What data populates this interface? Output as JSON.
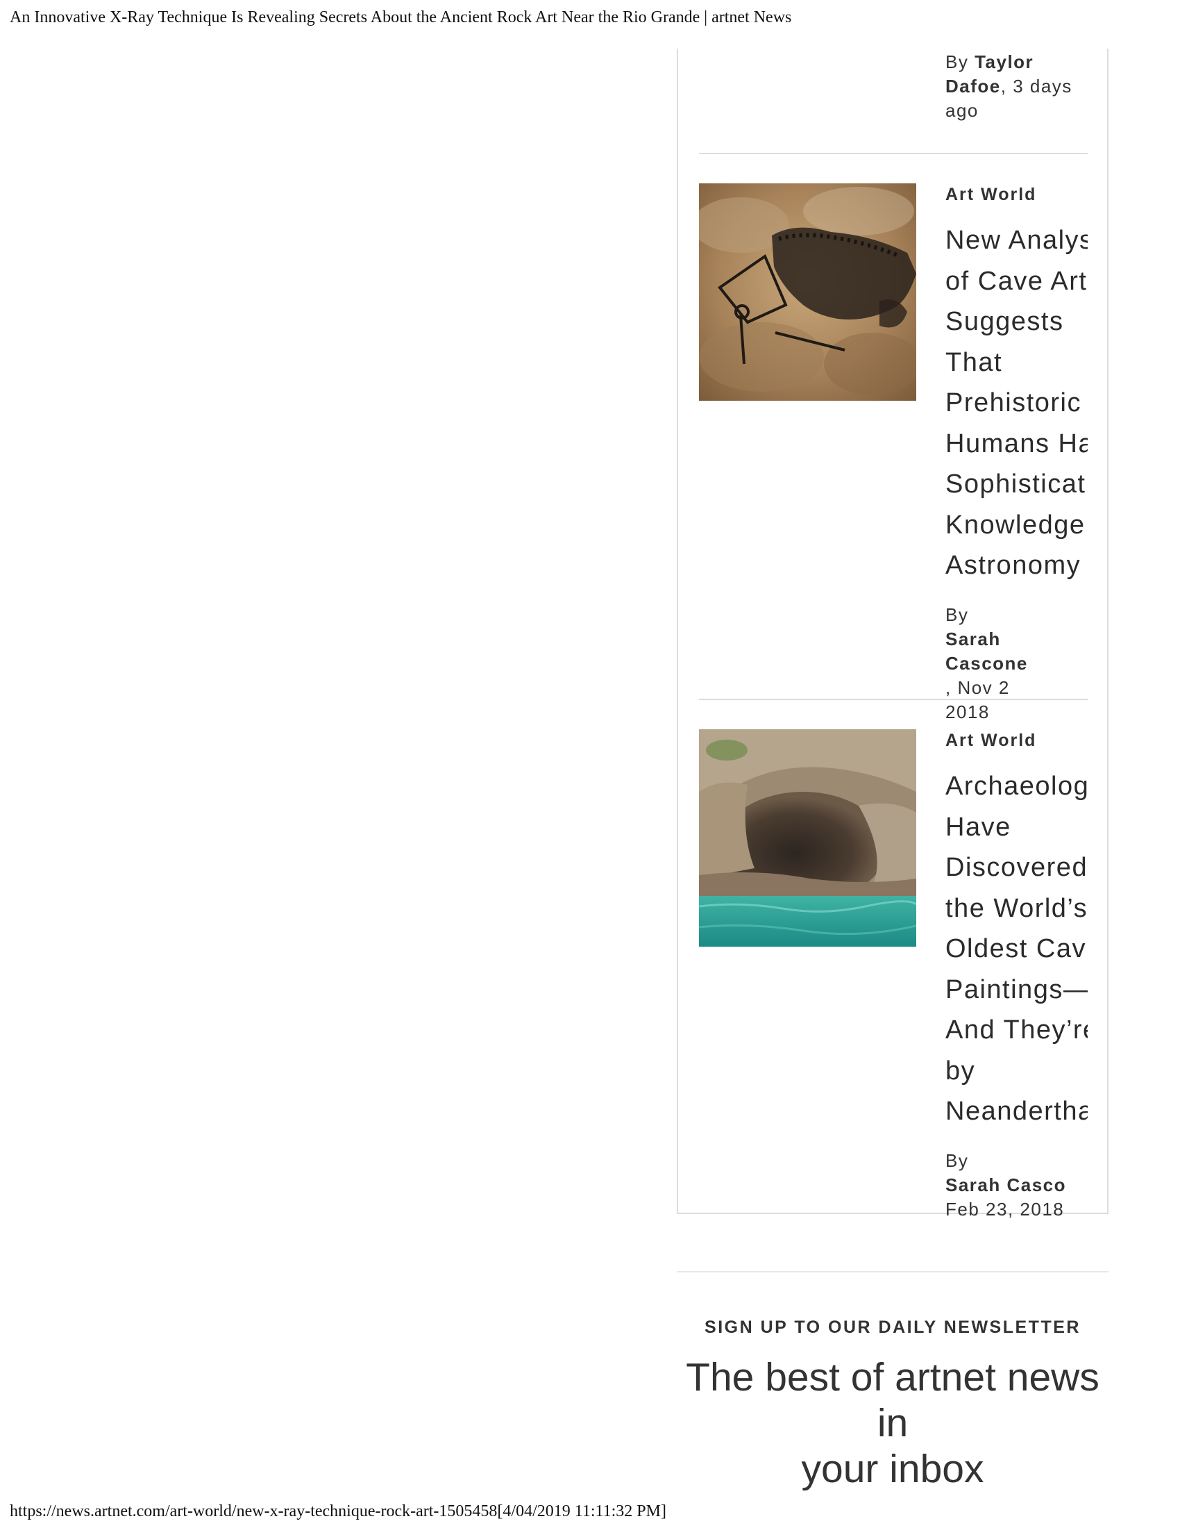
{
  "print": {
    "page_title": "An Innovative X-Ray Technique Is Revealing Secrets About the Ancient Rock Art Near the Rio Grande | artnet News",
    "footer_url": "https://news.artnet.com/art-world/new-x-ray-technique-rock-art-1505458[4/04/2019 11:11:32 PM]"
  },
  "related": {
    "top_byline": {
      "by": "By ",
      "author_line1": "Taylor",
      "author_line2": "Dafoe",
      "date_line2": ", 3 days",
      "date_line3": "ago"
    },
    "articles": [
      {
        "category": "Art World",
        "headline_lines": [
          "New Analys",
          "of Cave Art",
          "Suggests",
          "That",
          "Prehistoric",
          "Humans Ha",
          "Sophisticat",
          "Knowledge",
          "Astronomy"
        ],
        "by": "By ",
        "author_line1": "Sarah",
        "author_line2": "Cascone",
        "date_line2": ", Nov 2",
        "date_line3": "2018",
        "image_icon": "cave-painting-image"
      },
      {
        "category": "Art World",
        "headline_lines": [
          "Archaeolog",
          "Have",
          "Discovered",
          "the World’s",
          "Oldest Cav",
          "Paintings—",
          "And They’re",
          "by",
          "Neandertha"
        ],
        "by": "By ",
        "author_line1": "Sarah Casco",
        "date_line2": "Feb 23, 2018",
        "image_icon": "sea-cave-image"
      }
    ]
  },
  "newsletter": {
    "kicker": "SIGN UP TO OUR DAILY NEWSLETTER",
    "title_line1": "The best of artnet news in",
    "title_line2": "your inbox"
  }
}
